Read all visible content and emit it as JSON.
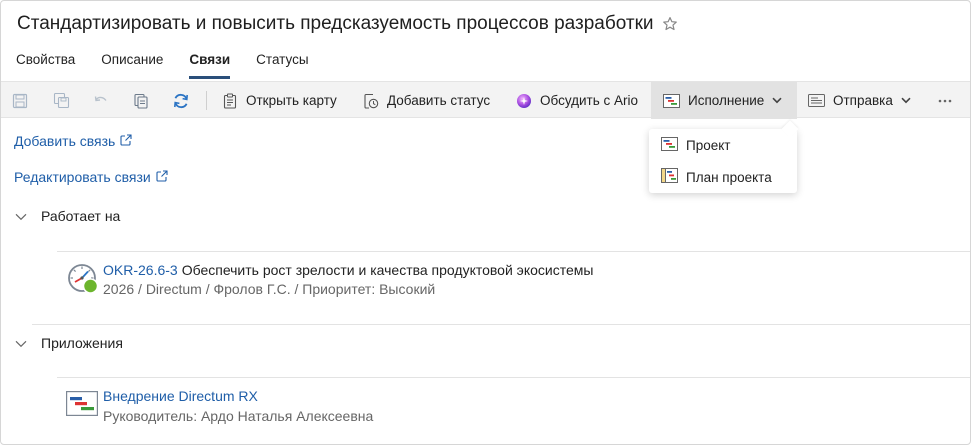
{
  "header": {
    "title": "Стандартизировать и повысить предсказуемость процессов разработки"
  },
  "tabs": [
    {
      "label": "Свойства"
    },
    {
      "label": "Описание"
    },
    {
      "label": "Связи",
      "active": true
    },
    {
      "label": "Статусы"
    }
  ],
  "toolbar": {
    "open_card": "Открыть карту",
    "add_status": "Добавить статус",
    "discuss": "Обсудить с Ario",
    "execution": "Исполнение",
    "send": "Отправка",
    "icons": [
      "save-icon",
      "save-all-icon",
      "undo-icon",
      "copy-icon",
      "refresh-icon",
      "card-icon",
      "status-icon",
      "ario-icon",
      "execution-icon",
      "send-icon",
      "more-icon"
    ]
  },
  "dropdown": {
    "items": [
      {
        "label": "Проект",
        "icon": "project-icon"
      },
      {
        "label": "План проекта",
        "icon": "project-plan-icon"
      }
    ]
  },
  "links": {
    "add": "Добавить связь",
    "edit": "Редактировать связи"
  },
  "sections": [
    {
      "label": "Работает на",
      "item": {
        "code": "OKR-26.6-3",
        "title": "Обеспечить рост зрелости и качества продуктовой экосистемы",
        "subtitle": "2026 / Directum  / Фролов Г.С. / Приоритет: Высокий"
      }
    },
    {
      "label": "Приложения",
      "item": {
        "code": "Внедрение Directum RX",
        "title": "",
        "subtitle": "Руководитель: Ардо Наталья Алексеевна"
      }
    }
  ],
  "colors": {
    "link": "#1f5ea8",
    "tab_underline": "#2a4f7a",
    "toolbar_bg": "#f3f3f3",
    "okr_status": "#6cb52d"
  }
}
